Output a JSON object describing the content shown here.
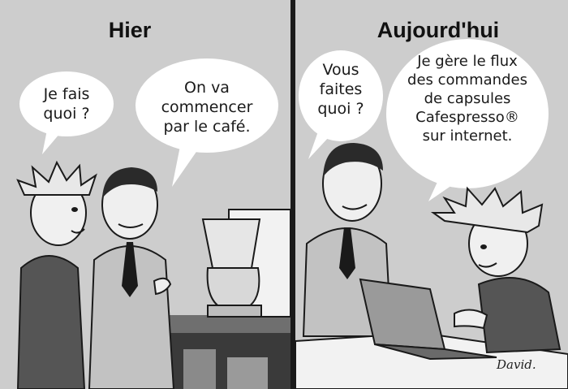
{
  "left_panel": {
    "title": "Hier",
    "bubble_1": "Je fais\nquoi ?",
    "bubble_2": "On va\ncommencer\npar le café."
  },
  "right_panel": {
    "title": "Aujourd'hui",
    "bubble_1": "Vous\nfaites\nquoi ?",
    "bubble_2": "Je gère le flux\ndes commandes\nde capsules\nCafespresso®\nsur internet."
  },
  "signature": "David.",
  "colors": {
    "background": "#cfcfcf",
    "bubble": "#ffffff",
    "ink": "#1a1a1a",
    "panel_divider": "#1a1a1a"
  }
}
